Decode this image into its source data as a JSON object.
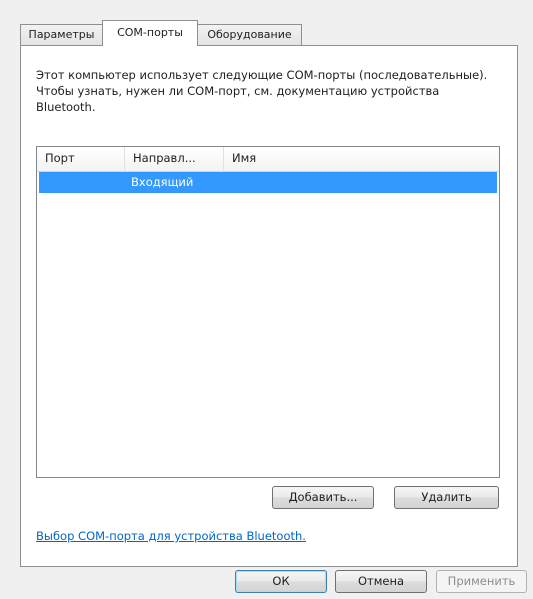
{
  "tabs": [
    {
      "label": "Параметры",
      "active": false
    },
    {
      "label": "COM-порты",
      "active": true
    },
    {
      "label": "Оборудование",
      "active": false
    }
  ],
  "description": "Этот компьютер использует следующие COM-порты (последовательные). Чтобы узнать, нужен ли COM-порт, см. документацию устройства Bluetooth.",
  "listview": {
    "columns": [
      "Порт",
      "Направл...",
      "Имя"
    ],
    "rows": [
      {
        "port": "",
        "direction": "Входящий",
        "name": "",
        "selected": true
      }
    ]
  },
  "buttons": {
    "add": "Добавить...",
    "remove": "Удалить",
    "ok": "ОК",
    "cancel": "Отмена",
    "apply": "Применить"
  },
  "link": "Выбор COM-порта для устройства Bluetooth.",
  "colors": {
    "selection": "#3399ff",
    "link": "#0066cc",
    "dialog_background": "#f0f0f0"
  }
}
